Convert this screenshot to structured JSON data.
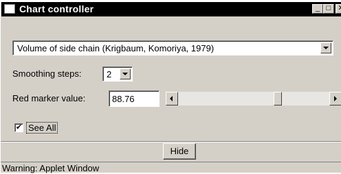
{
  "window": {
    "title": "Chart controller",
    "buttons": {
      "minimize": "_",
      "maximize": "□",
      "close": "✕"
    }
  },
  "property_select": {
    "value": "Volume of side chain (Krigbaum, Komoriya, 1979)"
  },
  "smoothing": {
    "label": "Smoothing steps:",
    "value": "2"
  },
  "red_marker": {
    "label": "Red marker value:",
    "value": "88.76",
    "slider_fraction": 0.67
  },
  "see_all": {
    "label": "See All",
    "checked": true,
    "check_glyph": "✔"
  },
  "hide_button": {
    "label": "Hide"
  },
  "status_bar": {
    "text": "Warning: Applet Window"
  },
  "colors": {
    "titlebar": "#000000",
    "face": "#d4d0c8",
    "field": "#ffffff"
  }
}
